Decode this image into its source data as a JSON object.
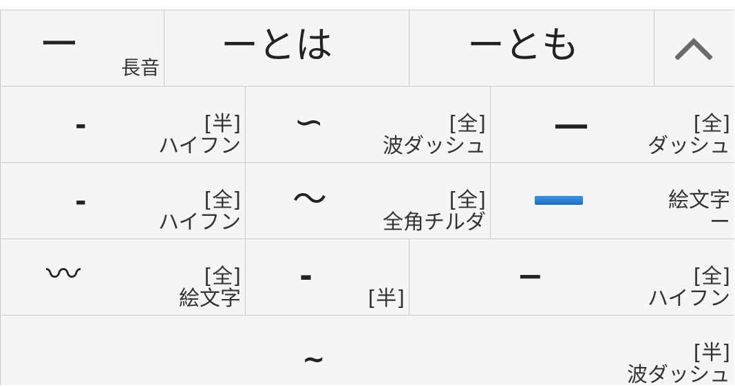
{
  "candidates": {
    "c1": {
      "main": "ー",
      "sub": "長音"
    },
    "c2": {
      "main": "ーとは"
    },
    "c3": {
      "main": "ーとも"
    },
    "expand_icon": "chevron-up-icon"
  },
  "grid": {
    "r1": [
      {
        "main": "-",
        "sub1": "[半]",
        "sub2": "ハイフン"
      },
      {
        "main": "∽",
        "sub1": "[全]",
        "sub2": "波ダッシュ"
      },
      {
        "main": "―",
        "sub1": "[全]",
        "sub2": "ダッシュ"
      }
    ],
    "r2": [
      {
        "main": "-",
        "sub1": "[全]",
        "sub2": "ハイフン"
      },
      {
        "main": "～",
        "sub1": "[全]",
        "sub2": "全角チルダ"
      },
      {
        "main": "",
        "sub1": "絵文字",
        "sub2": "ー",
        "icon": "blue-bar-emoji-icon"
      }
    ],
    "r3": [
      {
        "main": "〰",
        "sub1": "[全]",
        "sub2": "絵文字"
      },
      {
        "main": "-",
        "sub1": "[半]"
      },
      {
        "main": "−",
        "sub1": "[全]",
        "sub2": "ハイフン"
      }
    ],
    "r4": [
      {
        "main": "~",
        "sub1": "[半]",
        "sub2": "波ダッシュ"
      }
    ]
  }
}
